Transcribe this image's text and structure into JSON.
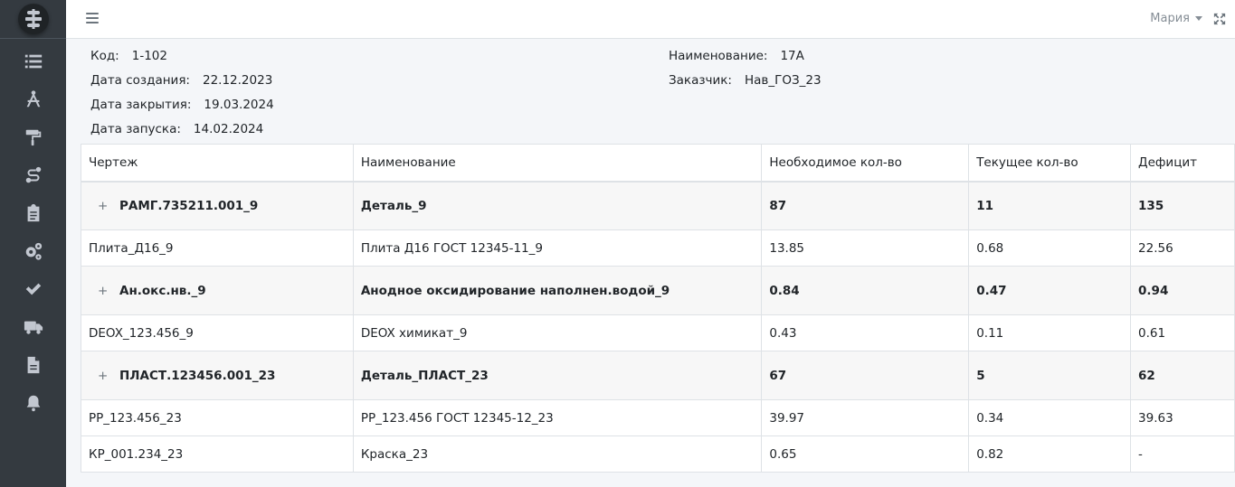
{
  "user": {
    "name": "Мария"
  },
  "sidebar": {
    "icons": [
      "list-icon",
      "compass-drafting-icon",
      "paint-roller-icon",
      "route-icon",
      "clipboard-icon",
      "cogs-icon",
      "check-icon",
      "truck-icon",
      "file-pdf-icon",
      "bell-icon"
    ]
  },
  "order": {
    "code_label": "Код:",
    "code": "1-102",
    "created_label": "Дата создания:",
    "created": "22.12.2023",
    "closed_label": "Дата закрытия:",
    "closed": "19.03.2024",
    "launch_label": "Дата запуска:",
    "launch": "14.02.2024",
    "name_label": "Наименование:",
    "name": "17А",
    "customer_label": "Заказчик:",
    "customer": "Нав_ГОЗ_23"
  },
  "table": {
    "headers": [
      "Чертеж",
      "Наименование",
      "Необходимое кол-во",
      "Текущее кол-во",
      "Дефицит"
    ],
    "rows": [
      {
        "expand": "+",
        "cells": [
          "РАМГ.735211.001_9",
          "Деталь_9",
          "87",
          "11",
          "135"
        ]
      },
      {
        "cells": [
          "Плита_Д16_9",
          "Плита Д16 ГОСТ 12345-11_9",
          "13.85",
          "0.68",
          "22.56"
        ]
      },
      {
        "expand": "+",
        "cells": [
          "Ан.окс.нв._9",
          "Анодное оксидирование наполнен.водой_9",
          "0.84",
          "0.47",
          "0.94"
        ]
      },
      {
        "cells": [
          "DEOX_123.456_9",
          "DEOX химикат_9",
          "0.43",
          "0.11",
          "0.61"
        ]
      },
      {
        "expand": "+",
        "cells": [
          "ПЛАСТ.123456.001_23",
          "Деталь_ПЛАСТ_23",
          "67",
          "5",
          "62"
        ]
      },
      {
        "cells": [
          "РР_123.456_23",
          "РР_123.456 ГОСТ 12345-12_23",
          "39.97",
          "0.34",
          "39.63"
        ]
      },
      {
        "cells": [
          "КР_001.234_23",
          "Краска_23",
          "0.65",
          "0.82",
          "-"
        ]
      }
    ]
  }
}
